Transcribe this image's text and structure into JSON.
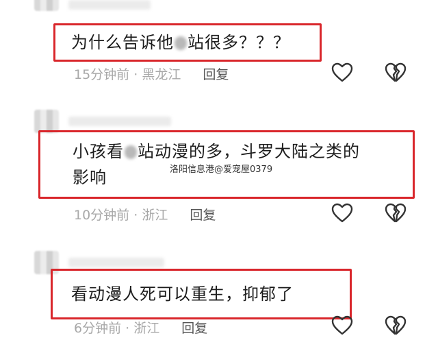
{
  "comments": [
    {
      "text_parts": [
        "为什么告诉他",
        "站很多？？？"
      ],
      "time": "15分钟前",
      "separator": "·",
      "location": "黑龙江",
      "reply_label": "回复"
    },
    {
      "text_line1_parts": [
        "小孩看",
        "站动漫的多，斗罗大陆之类的"
      ],
      "text_line2": "影响",
      "time": "10分钟前",
      "separator": "·",
      "location": "浙江",
      "reply_label": "回复"
    },
    {
      "text": "看动漫人死可以重生，抑郁了",
      "time": "6分钟前",
      "separator": "·",
      "location": "浙江",
      "reply_label": "回复"
    }
  ],
  "watermark": "洛阳信息港@爱宠屋0379",
  "icons": {
    "like": "heart-outline-icon",
    "dislike": "broken-heart-icon"
  },
  "colors": {
    "highlight_border": "#d9262b",
    "meta_text": "#a8a8a8",
    "icon_stroke": "#333333"
  }
}
